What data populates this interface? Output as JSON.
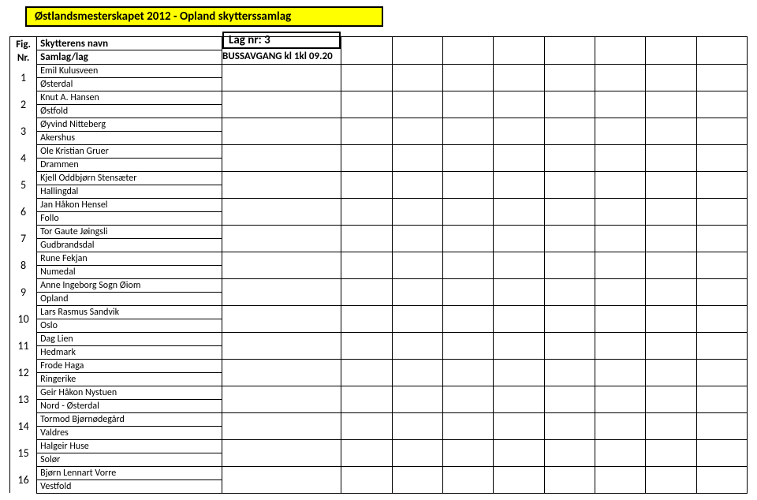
{
  "header": {
    "title": "Østlandsmesterskapet 2012 - Opland skytterssamlag"
  },
  "lag_box": "Lag nr: 3",
  "buss_label": "BUSSAVGANG kl 1kl 09.20",
  "columns": {
    "fig_nr": "Fig. Nr.",
    "name_header1": "Skytterens navn",
    "name_header2": "Samlag/lag"
  },
  "rows": [
    {
      "num": "1",
      "name": "Emil Kulusveen",
      "club": "Østerdal"
    },
    {
      "num": "2",
      "name": "Knut A. Hansen",
      "club": "Østfold"
    },
    {
      "num": "3",
      "name": "Øyvind Nitteberg",
      "club": "Akershus"
    },
    {
      "num": "4",
      "name": "Ole Kristian Gruer",
      "club": "Drammen"
    },
    {
      "num": "5",
      "name": "Kjell Oddbjørn Stensæter",
      "club": "Hallingdal"
    },
    {
      "num": "6",
      "name": "Jan Håkon Hensel",
      "club": "Follo"
    },
    {
      "num": "7",
      "name": "Tor Gaute Jøingsli",
      "club": "Gudbrandsdal"
    },
    {
      "num": "8",
      "name": "Rune Fekjan",
      "club": "Numedal"
    },
    {
      "num": "9",
      "name": "Anne Ingeborg Sogn Øiom",
      "club": "Opland"
    },
    {
      "num": "10",
      "name": "Lars Rasmus Sandvik",
      "club": "Oslo"
    },
    {
      "num": "11",
      "name": "Dag Lien",
      "club": "Hedmark"
    },
    {
      "num": "12",
      "name": "Frode Haga",
      "club": "Ringerike"
    },
    {
      "num": "13",
      "name": "Geir Håkon Nystuen",
      "club": "Nord - Østerdal"
    },
    {
      "num": "14",
      "name": "Tormod Bjørnødegård",
      "club": "Valdres"
    },
    {
      "num": "15",
      "name": "Halgeir Huse",
      "club": "Solør"
    },
    {
      "num": "16",
      "name": "Bjørn Lennart Vorre",
      "club": "Vestfold"
    }
  ]
}
